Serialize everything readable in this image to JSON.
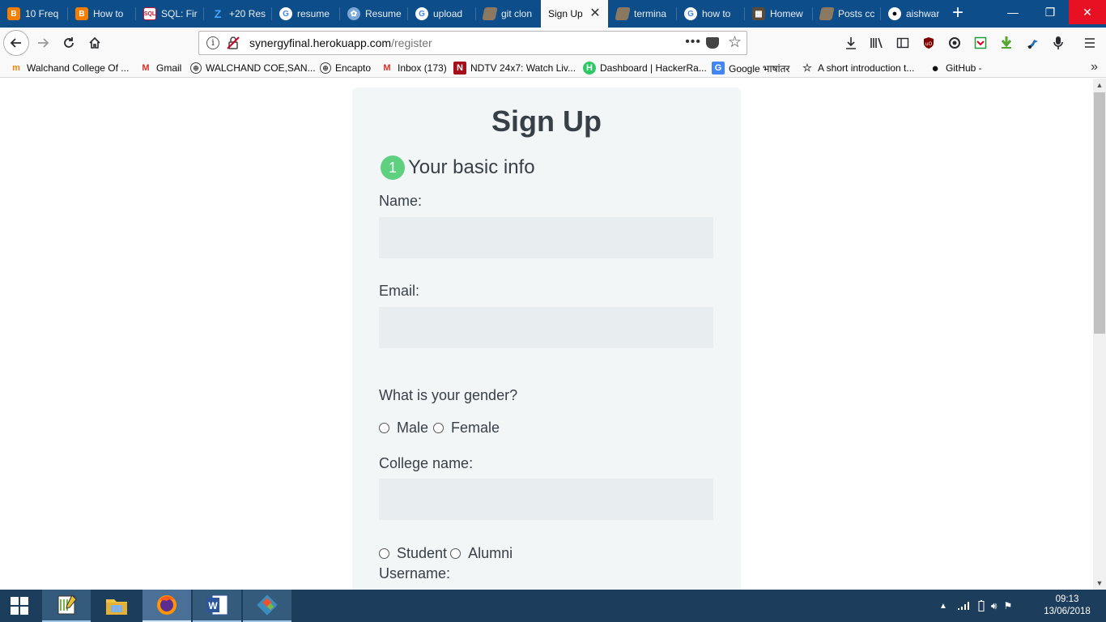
{
  "browser": {
    "tabs": [
      {
        "label": "10 Freq",
        "icon": "blogger-icon",
        "color": "#f57d00"
      },
      {
        "label": "How to",
        "icon": "blogger-icon",
        "color": "#f57d00"
      },
      {
        "label": "SQL: Fir",
        "icon": "sql-site-icon",
        "color": "#c8102e"
      },
      {
        "label": "+20 Res",
        "icon": "z-site-icon",
        "color": "#2a8af0"
      },
      {
        "label": "resume",
        "icon": "google-icon",
        "color": "#ffffff"
      },
      {
        "label": "Resume",
        "icon": "resume-site-icon",
        "color": "#7aa7d8"
      },
      {
        "label": "upload",
        "icon": "google-icon",
        "color": "#ffffff"
      },
      {
        "label": "git clon",
        "icon": "page-icon",
        "color": "#8a7860"
      },
      {
        "label": "Sign Up",
        "icon": "",
        "color": "",
        "active": true
      },
      {
        "label": "termina",
        "icon": "page-icon",
        "color": "#8a7860"
      },
      {
        "label": "how to",
        "icon": "google-icon",
        "color": "#ffffff"
      },
      {
        "label": "Homew",
        "icon": "homework-site-icon",
        "color": "#5a4a3a"
      },
      {
        "label": "Posts cc",
        "icon": "page-icon",
        "color": "#8a7860"
      },
      {
        "label": "aishwar",
        "icon": "github-icon",
        "color": "#ffffff"
      }
    ],
    "url_host": "synergyfinal.herokuapp.com",
    "url_path": "/register",
    "page_actions": "•••",
    "bookmarks": [
      {
        "label": "Walchand College Of ...",
        "icon": "moodle-icon"
      },
      {
        "label": "Gmail",
        "icon": "gmail-icon"
      },
      {
        "label": "WALCHAND COE,SAN...",
        "icon": "globe-icon"
      },
      {
        "label": "Encapto",
        "icon": "globe-icon"
      },
      {
        "label": "Inbox (173)",
        "icon": "gmail-icon"
      },
      {
        "label": "NDTV 24x7: Watch Liv...",
        "icon": "ndtv-icon"
      },
      {
        "label": "Dashboard | HackerRa...",
        "icon": "hackerrank-icon"
      },
      {
        "label": "Google भाषांतर",
        "icon": "google-translate-icon"
      },
      {
        "label": "A short introduction t...",
        "icon": "bookmark-page-icon"
      },
      {
        "label": "GitHub -",
        "icon": "github-icon"
      }
    ]
  },
  "form": {
    "title": "Sign Up",
    "step_number": "1",
    "step_title": "Your basic info",
    "name_label": "Name:",
    "email_label": "Email:",
    "gender_question": "What is your gender?",
    "gender_options": [
      "Male",
      "Female"
    ],
    "college_label": "College name:",
    "role_options": [
      "Student",
      "Alumni"
    ],
    "username_label": "Username:",
    "accent_color": "#5fcf80"
  },
  "taskbar": {
    "apps": [
      {
        "name": "notepad-plus-icon"
      },
      {
        "name": "file-explorer-icon"
      },
      {
        "name": "firefox-icon"
      },
      {
        "name": "word-icon"
      },
      {
        "name": "git-icon"
      }
    ],
    "time": "09:13",
    "date": "13/06/2018"
  }
}
